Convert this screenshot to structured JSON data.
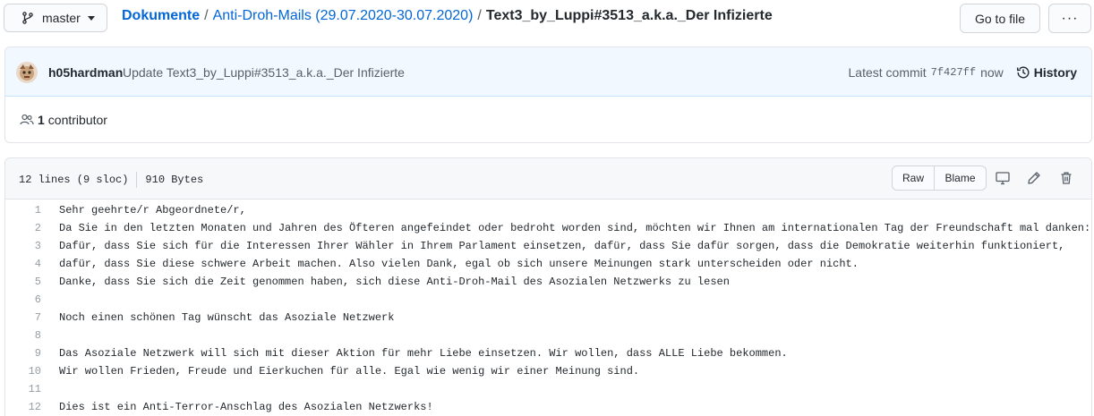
{
  "top": {
    "branch": "master",
    "breadcrumb": {
      "root": "Dokumente",
      "folder": "Anti-Droh-Mails (29.07.2020-30.07.2020)",
      "separator": "/",
      "file": "Text3_by_Luppi#3513_a.k.a._Der Infizierte"
    },
    "goto_file_label": "Go to file",
    "more_label": "···"
  },
  "commit": {
    "author": "h05hardman",
    "message": "Update Text3_by_Luppi#3513_a.k.a._Der Infizierte",
    "latest_label": "Latest commit",
    "sha": "7f427ff",
    "time": "now",
    "history_label": "History"
  },
  "contributors": {
    "count": "1",
    "label": "contributor"
  },
  "file": {
    "lines_info": "12 lines (9 sloc)",
    "size": "910 Bytes",
    "raw_label": "Raw",
    "blame_label": "Blame",
    "lines": [
      {
        "n": "1",
        "text": "Sehr geehrte/r Abgeordnete/r,"
      },
      {
        "n": "2",
        "text": "Da Sie in den letzten Monaten und Jahren des Öfteren angefeindet oder bedroht worden sind, möchten wir Ihnen am internationalen Tag der Freundschaft mal danken:"
      },
      {
        "n": "3",
        "text": "Dafür, dass Sie sich für die Interessen Ihrer Wähler in Ihrem Parlament einsetzen, dafür, dass Sie dafür sorgen, dass die Demokratie weiterhin funktioniert,"
      },
      {
        "n": "4",
        "text": "dafür, dass Sie diese schwere Arbeit machen. Also vielen Dank, egal ob sich unsere Meinungen stark unterscheiden oder nicht."
      },
      {
        "n": "5",
        "text": "Danke, dass Sie sich die Zeit genommen haben, sich diese Anti-Droh-Mail des Asozialen Netzwerks zu lesen"
      },
      {
        "n": "6",
        "text": ""
      },
      {
        "n": "7",
        "text": "Noch einen schönen Tag wünscht das Asoziale Netzwerk"
      },
      {
        "n": "8",
        "text": ""
      },
      {
        "n": "9",
        "text": "Das Asoziale Netzwerk will sich mit dieser Aktion für mehr Liebe einsetzen. Wir wollen, dass ALLE Liebe bekommen."
      },
      {
        "n": "10",
        "text": "Wir wollen Frieden, Freude und Eierkuchen für alle. Egal wie wenig wir einer Meinung sind."
      },
      {
        "n": "11",
        "text": ""
      },
      {
        "n": "12",
        "text": "Dies ist ein Anti-Terror-Anschlag des Asozialen Netzwerks!"
      }
    ]
  },
  "icons": {
    "branch": "git-branch-icon",
    "dropdown": "triangle-down-icon",
    "history": "history-clock-icon",
    "people": "people-icon",
    "desktop": "desktop-icon",
    "edit": "pencil-icon",
    "delete": "trash-icon"
  },
  "colors": {
    "link": "#0366d6",
    "commit_bg": "#f1f8ff",
    "header_bg": "#f6f8fa"
  }
}
